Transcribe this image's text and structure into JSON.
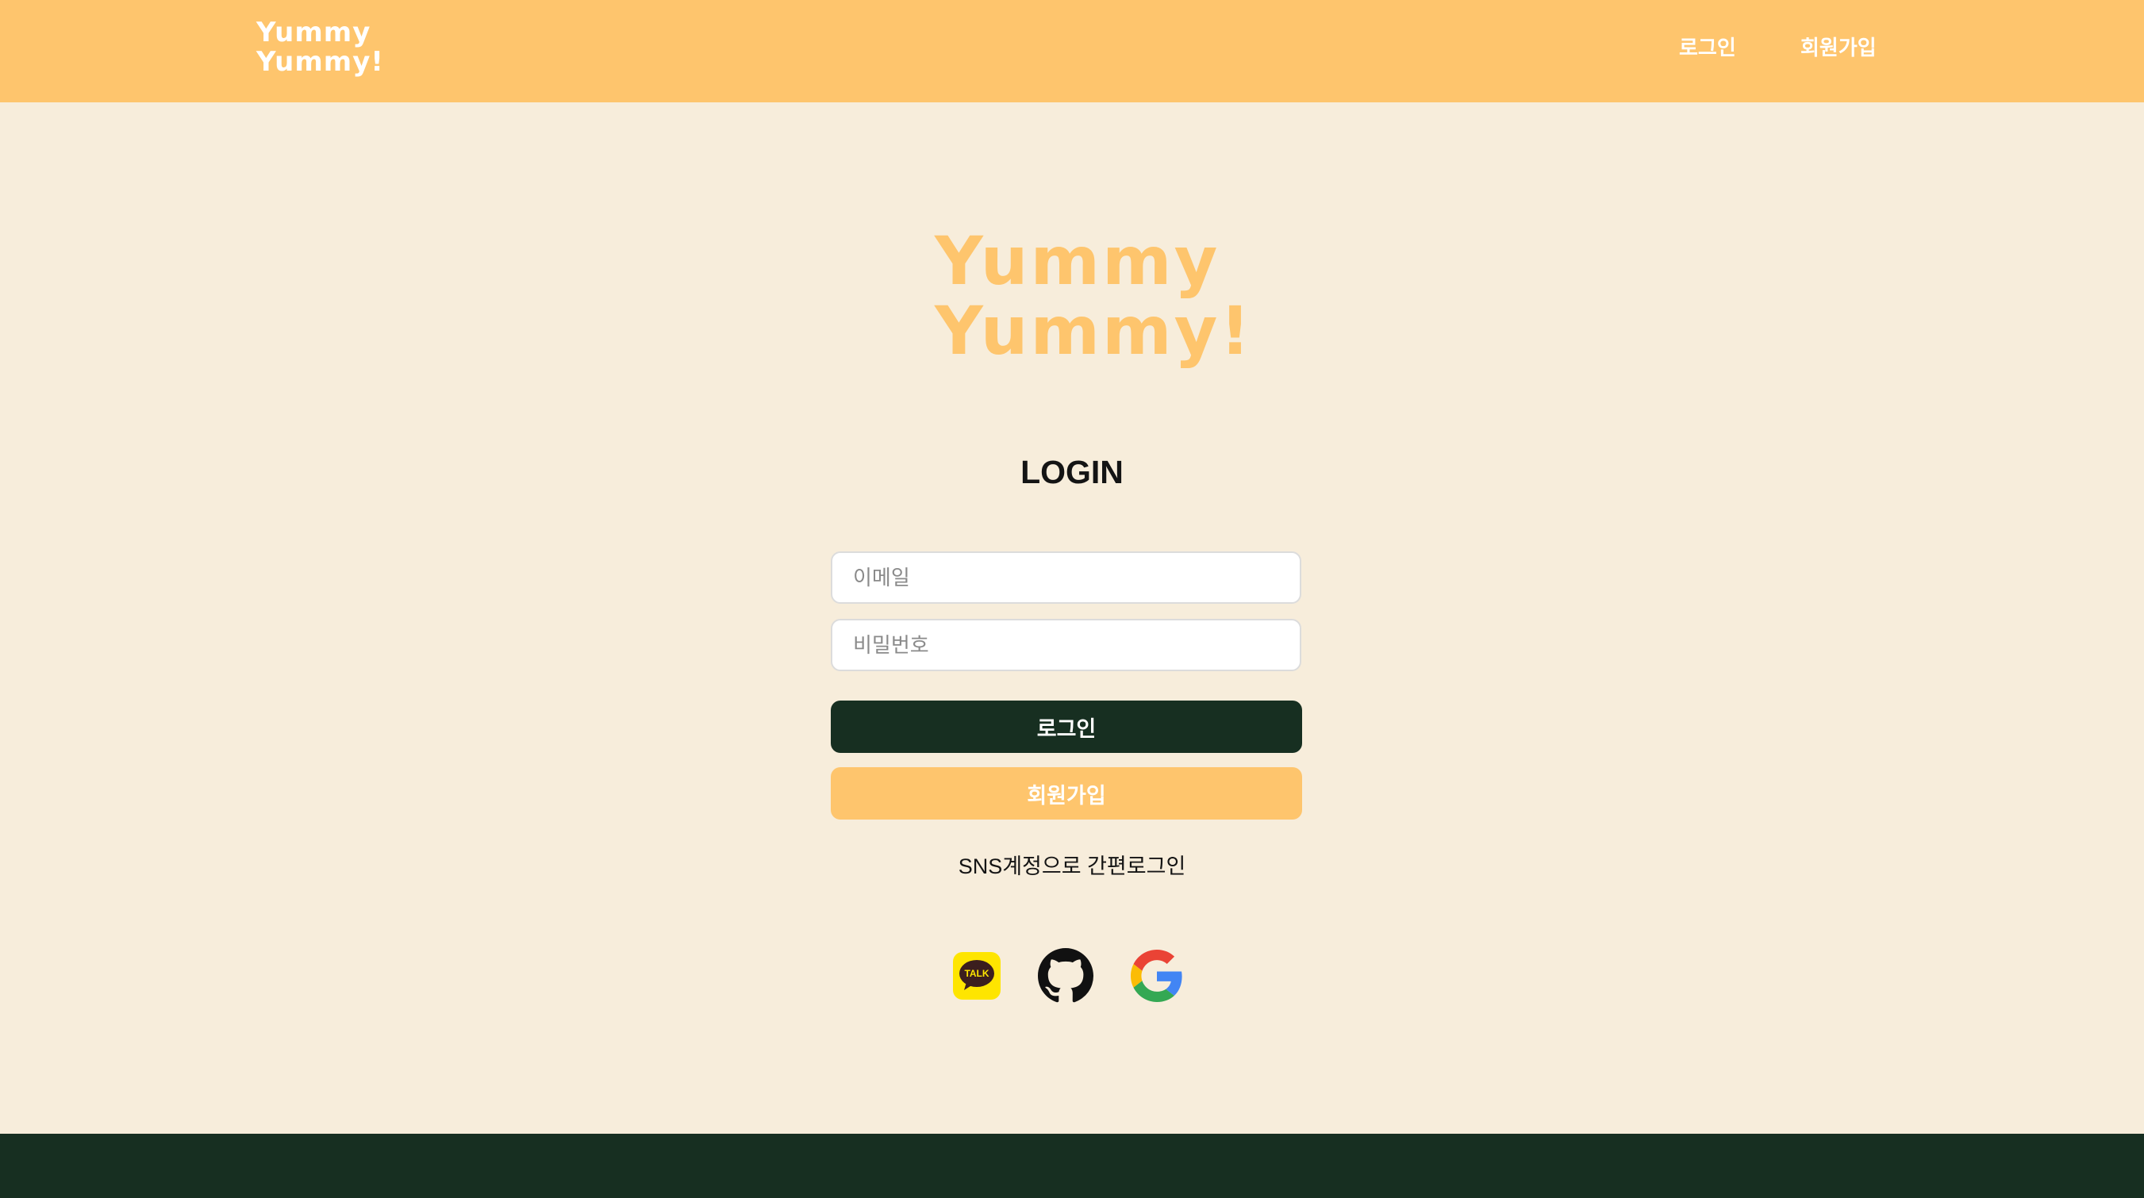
{
  "header": {
    "logo_line1": "Yummy",
    "logo_line2": "Yummy!",
    "nav": {
      "login": "로그인",
      "signup": "회원가입"
    }
  },
  "main": {
    "logo_line1": "Yummy",
    "logo_line2": "Yummy!",
    "title": "LOGIN",
    "email_placeholder": "이메일",
    "password_placeholder": "비밀번호",
    "login_button": "로그인",
    "signup_button": "회원가입",
    "sns_text": "SNS계정으로 간편로그인",
    "sns": {
      "kakao_label": "TALK",
      "icons": [
        "kakao-talk-icon",
        "github-icon",
        "google-icon"
      ]
    }
  },
  "colors": {
    "accent": "#fec56d",
    "dark": "#172f21",
    "background": "#f7eddb",
    "kakao": "#fee500"
  }
}
